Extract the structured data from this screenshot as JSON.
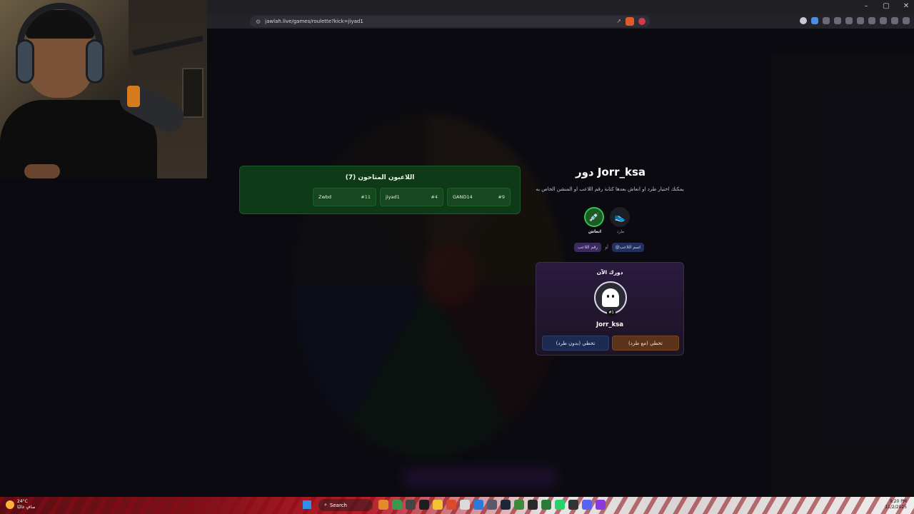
{
  "browser": {
    "url": "jawlah.live/games/roulette?kick=jiyad1",
    "window_controls": [
      "–",
      "▢",
      "✕"
    ]
  },
  "players_panel": {
    "title": "اللاعبون المتاحون (7)",
    "players": [
      {
        "name": "Zwbd",
        "number": "#11"
      },
      {
        "name": "jiyad1",
        "number": "#4"
      },
      {
        "name": "GAND14",
        "number": "#9"
      }
    ]
  },
  "turn": {
    "title": "دور Jorr_ksa",
    "description": "يمكنك اختيار طرد او انعاش بعدها كتابة رقم اللاعب او المنشن الخاص به",
    "actions": {
      "revive_label": "انعاش",
      "kick_label": "طرد"
    },
    "hint": {
      "player_number": "رقم اللاعب",
      "or": "أو",
      "player_name": "@اسم اللاعب"
    }
  },
  "current_turn_card": {
    "caption": "دورك الآن",
    "player_name": "Jorr_ksa",
    "player_badge": "#1",
    "skip_without_kick": "تخطي (بدون طرد)",
    "skip_with_kick": "تخطي (مع طرد)"
  },
  "taskbar": {
    "weather_temp": "24°C",
    "weather_desc": "صافٍ غالبًا",
    "search_label": "Search",
    "time": "9:20 PM",
    "date": "11/2/2025"
  },
  "colors": {
    "players_bg": "#0f3a18",
    "turn_card_bg": "#2a1a40",
    "revive_green": "#33c24a",
    "kick_red": "#ff6060"
  }
}
